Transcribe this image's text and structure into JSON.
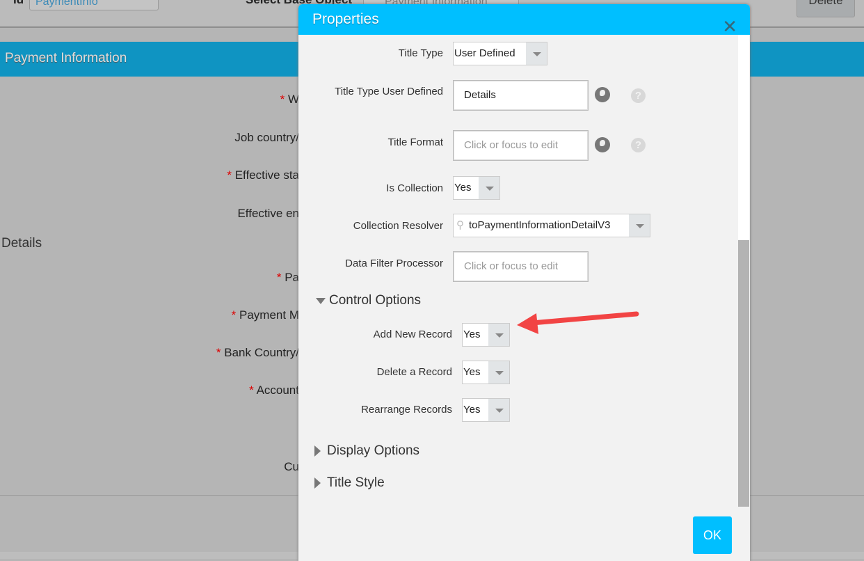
{
  "background": {
    "id_label": "Id",
    "id_value": "PaymentInfo",
    "base_object_label": "Select Base Object",
    "base_object_value": "Payment Information",
    "delete_label": "Delete",
    "band_title": "Payment Information",
    "fields": [
      {
        "label": "W",
        "required": true
      },
      {
        "label": "Job country/",
        "required": false
      },
      {
        "label": "Effective sta",
        "required": true
      },
      {
        "label": "Effective en",
        "required": false
      },
      {
        "label": "Pa",
        "required": true
      },
      {
        "label": "Payment M",
        "required": true
      },
      {
        "label": "Bank Country/",
        "required": true
      },
      {
        "label": "Account",
        "required": true
      },
      {
        "label": "Cu",
        "required": false
      }
    ],
    "details_heading": "Details",
    "required_mark": "*"
  },
  "dialog": {
    "title": "Properties",
    "close_icon": "close-icon",
    "title_type": {
      "label": "Title Type",
      "value": "User Defined"
    },
    "title_type_user_defined": {
      "label": "Title Type User Defined",
      "value": "Details"
    },
    "title_format": {
      "label": "Title Format",
      "placeholder": "Click or focus to edit"
    },
    "is_collection": {
      "label": "Is Collection",
      "value": "Yes"
    },
    "collection_resolver": {
      "label": "Collection Resolver",
      "value": "toPaymentInformationDetailV3"
    },
    "data_filter_processor": {
      "label": "Data Filter Processor",
      "placeholder": "Click or focus to edit"
    },
    "control_options": {
      "label": "Control Options",
      "expanded": true,
      "items": [
        {
          "label": "Add New Record",
          "value": "Yes"
        },
        {
          "label": "Delete a Record",
          "value": "Yes"
        },
        {
          "label": "Rearrange Records",
          "value": "Yes"
        }
      ]
    },
    "display_options": {
      "label": "Display Options",
      "expanded": false
    },
    "title_style": {
      "label": "Title Style",
      "expanded": false
    },
    "ok_label": "OK",
    "help_glyph": "?"
  },
  "colors": {
    "header": "#00bfff",
    "band": "#0f94c2",
    "annotation_arrow": "#f24444",
    "required": "#dd0000"
  }
}
